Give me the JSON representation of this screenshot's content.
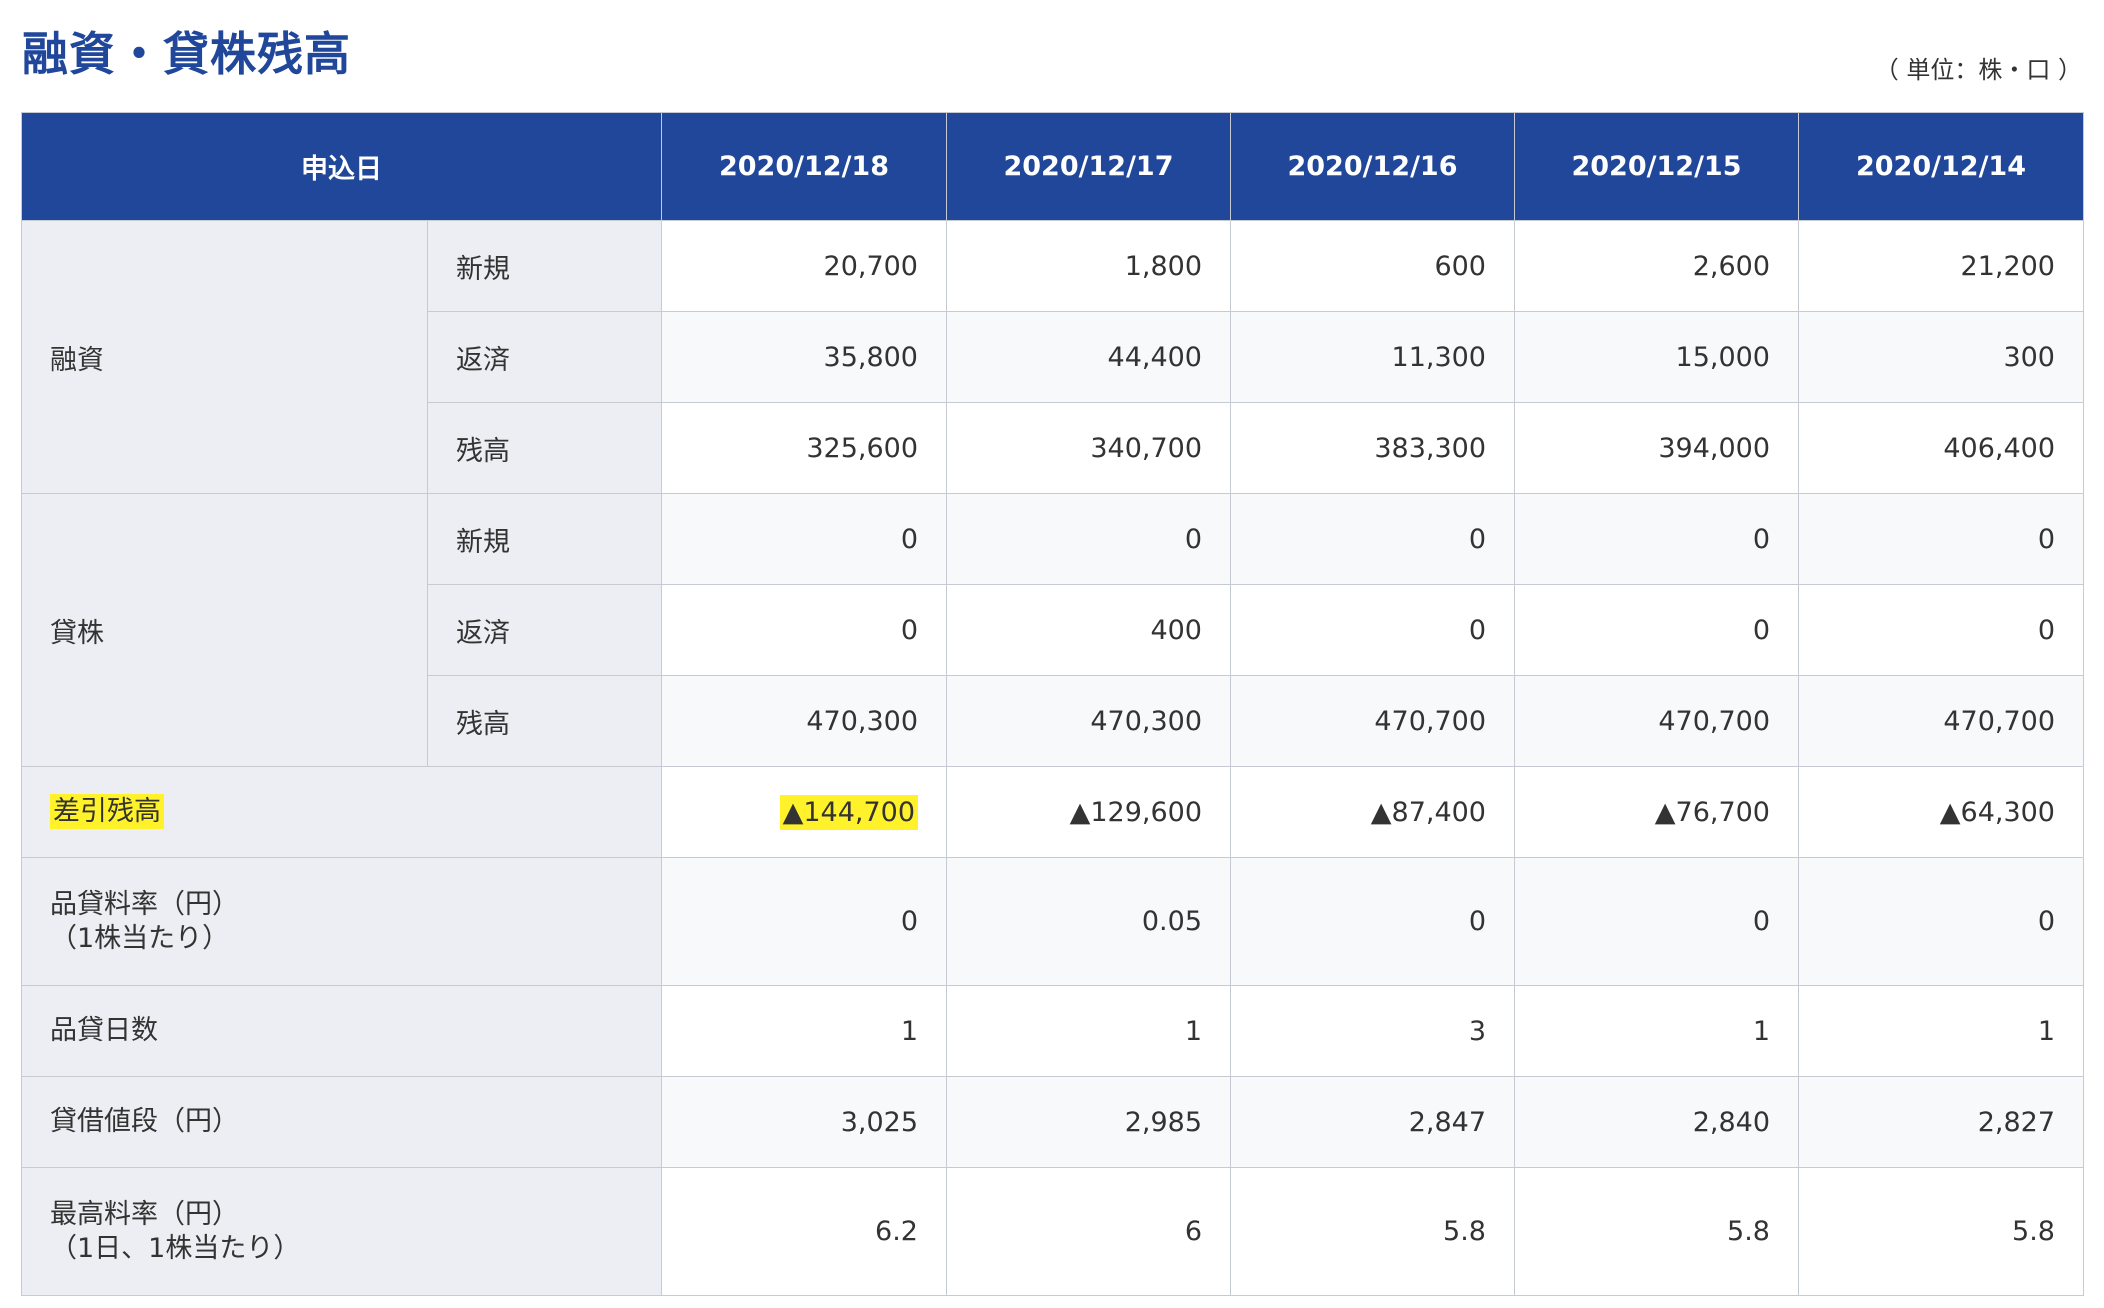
{
  "title": "融資・貸株残高",
  "unit_note": "（ 単位：株・口 ）",
  "header": {
    "label": "申込日",
    "dates": [
      "2020/12/18",
      "2020/12/17",
      "2020/12/16",
      "2020/12/15",
      "2020/12/14"
    ]
  },
  "rows": {
    "yushi": {
      "category": "融資",
      "new": {
        "label": "新規",
        "values": [
          "20,700",
          "1,800",
          "600",
          "2,600",
          "21,200"
        ]
      },
      "repay": {
        "label": "返済",
        "values": [
          "35,800",
          "44,400",
          "11,300",
          "15,000",
          "300"
        ]
      },
      "balance": {
        "label": "残高",
        "values": [
          "325,600",
          "340,700",
          "383,300",
          "394,000",
          "406,400"
        ]
      }
    },
    "kashikabu": {
      "category": "貸株",
      "new": {
        "label": "新規",
        "values": [
          "0",
          "0",
          "0",
          "0",
          "0"
        ]
      },
      "repay": {
        "label": "返済",
        "values": [
          "0",
          "400",
          "0",
          "0",
          "0"
        ]
      },
      "balance": {
        "label": "残高",
        "values": [
          "470,300",
          "470,300",
          "470,700",
          "470,700",
          "470,700"
        ]
      }
    },
    "net": {
      "label": "差引残高",
      "values": [
        "▲144,700",
        "▲129,600",
        "▲87,400",
        "▲76,700",
        "▲64,300"
      ]
    },
    "fee_rate": {
      "label_line1": "品貸料率（円）",
      "label_line2": "（1株当たり）",
      "values": [
        "0",
        "0.05",
        "0",
        "0",
        "0"
      ]
    },
    "fee_days": {
      "label": "品貸日数",
      "values": [
        "1",
        "1",
        "3",
        "1",
        "1"
      ]
    },
    "price": {
      "label": "貸借値段（円）",
      "values": [
        "3,025",
        "2,985",
        "2,847",
        "2,840",
        "2,827"
      ]
    },
    "max_rate": {
      "label_line1": "最高料率（円）",
      "label_line2": "（1日、1株当たり）",
      "values": [
        "6.2",
        "6",
        "5.8",
        "5.8",
        "5.8"
      ]
    }
  },
  "colors": {
    "header_bg": "#21479a",
    "title": "#21479a",
    "label_bg": "#eceef3",
    "highlight": "#fff22a"
  }
}
